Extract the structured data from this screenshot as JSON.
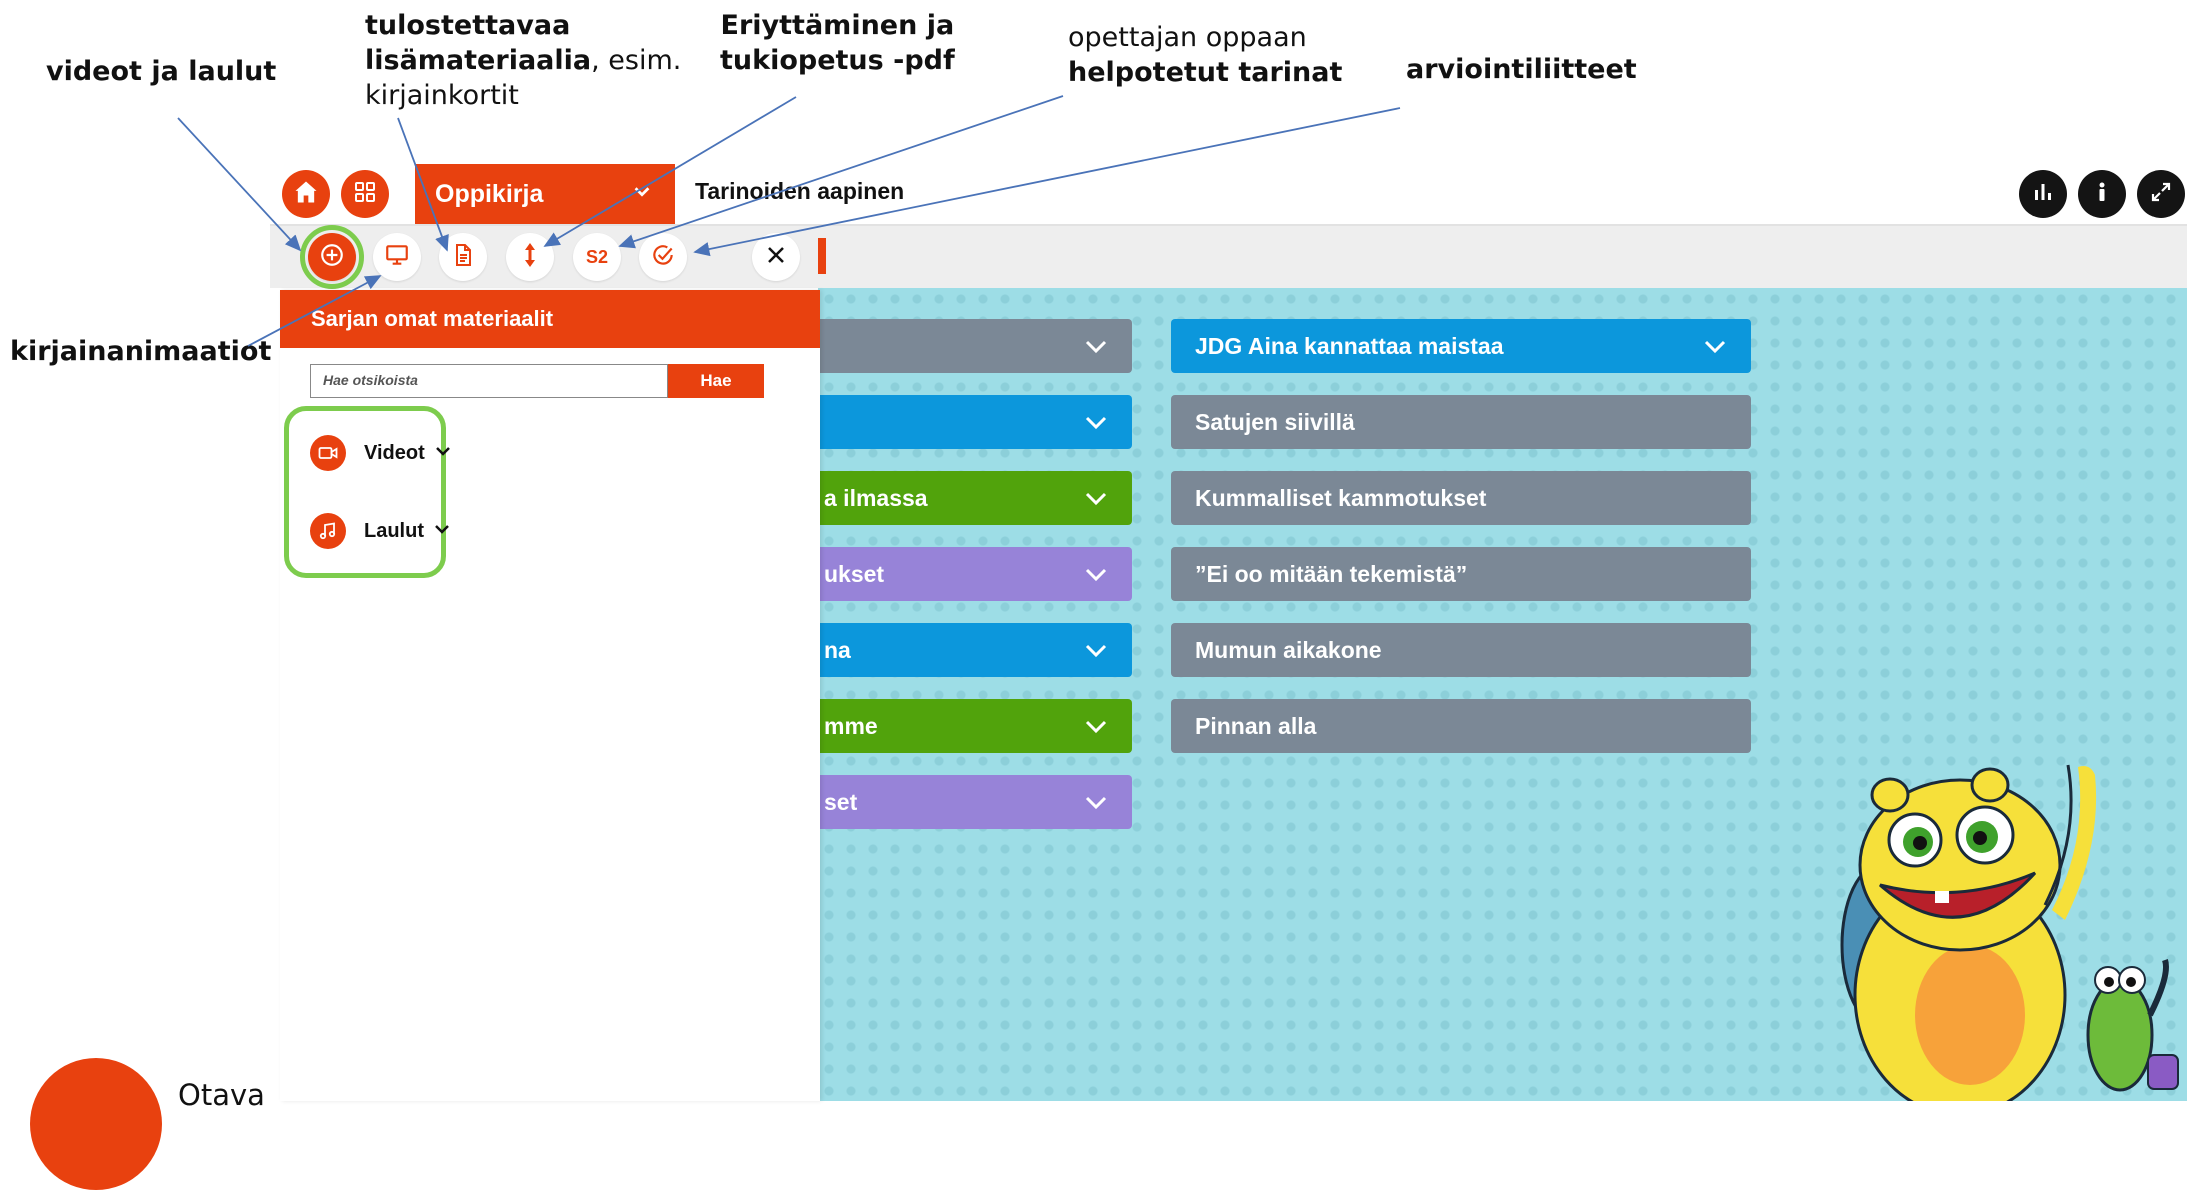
{
  "annotations": {
    "videos": "videot ja laulut",
    "print_1": "tulostettavaa",
    "print_2": "lisämateriaalia",
    "print_2b": ", esim.",
    "print_3": "kirjainkortit",
    "diff_1": "Eriyttäminen ja",
    "diff_2": "tukiopetus -pdf",
    "guide_1": "opettajan oppaan",
    "guide_2": "helpotetut tarinat",
    "assess": "arviointiliitteet",
    "anim": "kirjainanimaatiot"
  },
  "topbar": {
    "book_select": "Oppikirja",
    "book_title": "Tarinoiden aapinen"
  },
  "toolbar": {
    "s2_label": "S2"
  },
  "panel": {
    "title": "Sarjan omat materiaalit",
    "search_placeholder": "Hae otsikoista",
    "search_button": "Hae",
    "categories": [
      {
        "label": "Videot",
        "icon": "video-icon"
      },
      {
        "label": "Laulut",
        "icon": "music-icon"
      }
    ]
  },
  "chapters_left": [
    {
      "label": "",
      "color": "gray"
    },
    {
      "label": "",
      "color": "blue"
    },
    {
      "label": "a ilmassa",
      "color": "green"
    },
    {
      "label": "ukset",
      "color": "purple"
    },
    {
      "label": "na",
      "color": "blue"
    },
    {
      "label": "mme",
      "color": "green"
    },
    {
      "label": "set",
      "color": "purple"
    }
  ],
  "chapters_right": [
    {
      "label": "JDG Aina kannattaa maistaa",
      "color": "blue"
    },
    {
      "label": "Satujen siivillä",
      "color": "gray"
    },
    {
      "label": "Kummalliset kammotukset",
      "color": "gray"
    },
    {
      "label": "”Ei oo mitään tekemistä”",
      "color": "gray"
    },
    {
      "label": "Mumun aikakone",
      "color": "gray"
    },
    {
      "label": "Pinnan alla",
      "color": "gray"
    }
  ],
  "colors": {
    "accent": "#e8410f",
    "highlight": "#7dcc4d",
    "gray": "#7b8896",
    "blue": "#0c97dc",
    "green": "#51a30c",
    "purple": "#9783d8"
  },
  "logo": {
    "text": "Otava"
  }
}
